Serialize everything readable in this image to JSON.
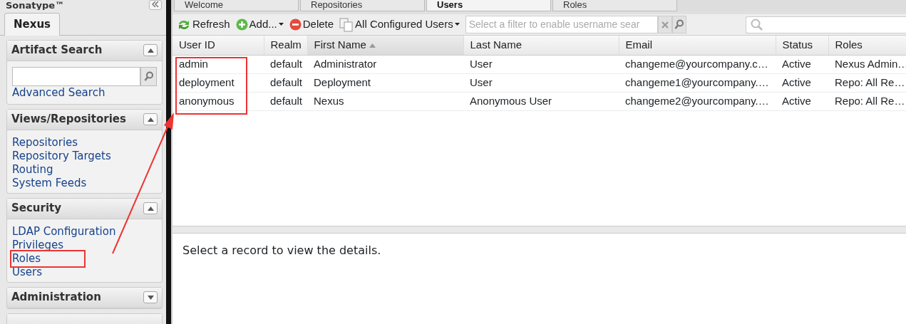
{
  "sidebar": {
    "brand": "Sonatype™",
    "tabs": [
      {
        "label": "Nexus",
        "selected": true
      }
    ],
    "panels": [
      {
        "title": "Artifact Search",
        "expanded": true,
        "kind": "search",
        "links": [
          {
            "label": "Advanced Search",
            "highlighted": false
          }
        ]
      },
      {
        "title": "Views/Repositories",
        "expanded": true,
        "kind": "links",
        "links": [
          {
            "label": "Repositories",
            "highlighted": false
          },
          {
            "label": "Repository Targets",
            "highlighted": false
          },
          {
            "label": "Routing",
            "highlighted": false
          },
          {
            "label": "System Feeds",
            "highlighted": false
          }
        ]
      },
      {
        "title": "Security",
        "expanded": true,
        "kind": "links",
        "links": [
          {
            "label": "LDAP Configuration",
            "highlighted": false
          },
          {
            "label": "Privileges",
            "highlighted": false
          },
          {
            "label": "Roles",
            "highlighted": true
          },
          {
            "label": "Users",
            "highlighted": false
          }
        ]
      },
      {
        "title": "Administration",
        "expanded": false
      }
    ]
  },
  "tabs": [
    {
      "label": "Welcome",
      "selected": false
    },
    {
      "label": "Repositories",
      "selected": false
    },
    {
      "label": "Users",
      "selected": true
    },
    {
      "label": "Roles",
      "selected": false
    }
  ],
  "toolbar": {
    "buttons": [
      {
        "label": "Refresh",
        "kind": "refresh",
        "dropdown": false
      },
      {
        "label": "Add...",
        "kind": "add",
        "dropdown": true
      },
      {
        "label": "Delete",
        "kind": "delete",
        "dropdown": false
      },
      {
        "label": "All Configured Users",
        "kind": "copy",
        "dropdown": true
      }
    ],
    "filter": {
      "placeholder": "Select a filter to enable username sear"
    }
  },
  "table": {
    "columns": [
      {
        "label": "User ID",
        "sorted": false,
        "highlighted": true
      },
      {
        "label": "Realm",
        "sorted": false,
        "highlighted": false
      },
      {
        "label": "First Name",
        "sorted": true,
        "highlighted": false
      },
      {
        "label": "Last Name",
        "sorted": false,
        "highlighted": false
      },
      {
        "label": "Email",
        "sorted": false,
        "highlighted": false
      },
      {
        "label": "Status",
        "sorted": false,
        "highlighted": false
      },
      {
        "label": "Roles",
        "sorted": false,
        "highlighted": false
      }
    ],
    "rows": [
      [
        "admin",
        "default",
        "Administrator",
        "User",
        "changeme@yourcompany.c…",
        "Active",
        "Nexus Admin…"
      ],
      [
        "deployment",
        "default",
        "Deployment",
        "User",
        "changeme1@yourcompany.…",
        "Active",
        "Repo: All Re…"
      ],
      [
        "anonymous",
        "default",
        "Nexus",
        "Anonymous User",
        "changeme2@yourcompany.…",
        "Active",
        "Repo: All Re…"
      ]
    ]
  },
  "detail": {
    "message": "Select a record to view the details."
  }
}
